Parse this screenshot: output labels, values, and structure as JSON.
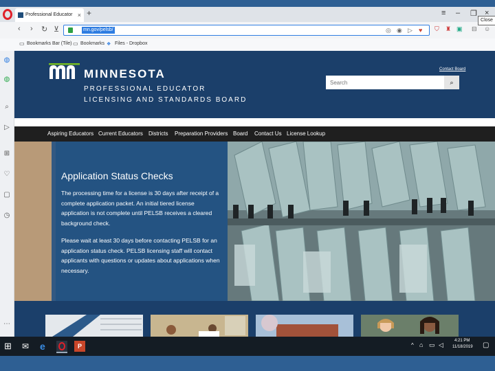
{
  "browser": {
    "tab_title": "Professional Educator Licen",
    "close_tooltip": "Close",
    "url": "mn.gov/pelsb/",
    "bookmarks": [
      {
        "label": "Bookmarks Bar (Tile)"
      },
      {
        "label": "Bookmarks"
      },
      {
        "label": "Files - Dropbox"
      }
    ]
  },
  "site": {
    "brand_line1": "MINNESOTA",
    "brand_line2": "PROFESSIONAL EDUCATOR",
    "brand_line3": "LICENSING AND STANDARDS BOARD",
    "contact_link": "Contact Board",
    "search_placeholder": "Search",
    "nav": [
      {
        "label": "Aspiring Educators"
      },
      {
        "label": "Current Educators"
      },
      {
        "label": "Districts"
      },
      {
        "label": "Preparation Providers"
      },
      {
        "label": "Board"
      },
      {
        "label": "Contact Us"
      },
      {
        "label": "License Lookup"
      }
    ],
    "hero": {
      "title": "Application Status Checks",
      "paragraph1": "The processing time for a license is 30 days after receipt of a complete application packet. An initial tiered license application is not complete until PELSB receives a cleared background check.",
      "paragraph2": "Please wait at least 30 days before contacting PELSB for an application status check. PELSB licensing staff will contact applicants with questions or updates about applications when necessary."
    }
  },
  "taskbar": {
    "time": "4:21 PM",
    "date": "11/18/2019"
  },
  "colors": {
    "header_blue": "#1b3f6a",
    "hero_panel_blue": "#164a84",
    "nav_black": "#1f1f1f",
    "opera_red": "#e0202a"
  }
}
